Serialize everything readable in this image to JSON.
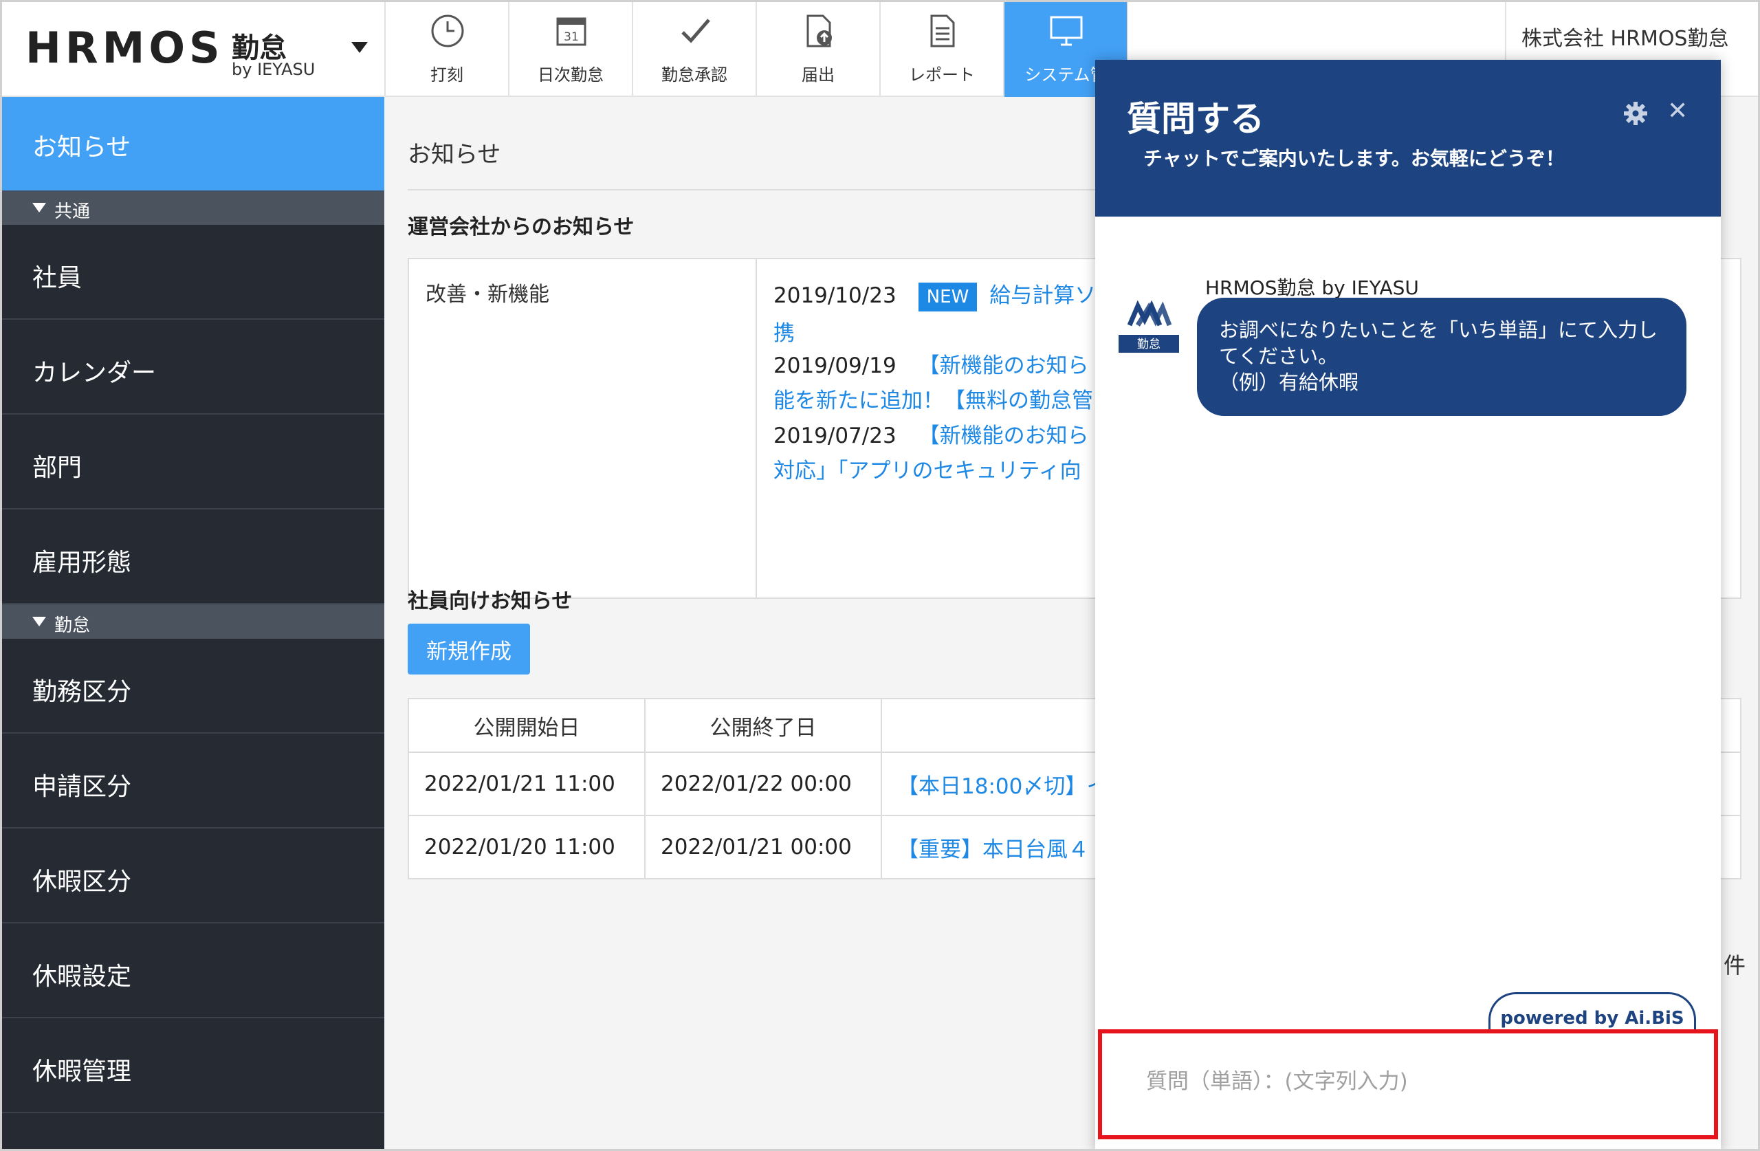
{
  "header": {
    "logo_text": "HRMOS",
    "logo_kintai": "勤怠",
    "logo_by": "by IEYASU",
    "company": "株式会社 HRMOS勤怠",
    "nav": [
      {
        "label": "打刻",
        "icon": "clock-icon"
      },
      {
        "label": "日次勤怠",
        "icon": "calendar-icon"
      },
      {
        "label": "勤怠承認",
        "icon": "checkmark-icon"
      },
      {
        "label": "届出",
        "icon": "document-upload-icon"
      },
      {
        "label": "レポート",
        "icon": "report-icon"
      },
      {
        "label": "システム管",
        "icon": "monitor-icon"
      }
    ]
  },
  "sidebar": {
    "active": "お知らせ",
    "section_common": "共通",
    "section_kintai": "勤怠",
    "items": [
      "社員",
      "カレンダー",
      "部門",
      "雇用形態",
      "勤務区分",
      "申請区分",
      "休暇区分",
      "休暇設定",
      "休暇管理"
    ]
  },
  "main": {
    "title": "お知らせ",
    "operator_title": "運営会社からのお知らせ",
    "category": "改善・新機能",
    "notices": [
      {
        "date": "2019/10/23",
        "badge": "NEW",
        "text": "給与計算ソ",
        "cont": "携"
      },
      {
        "date": "2019/09/19",
        "text": "【新機能のお知ら",
        "cont": "能を新たに追加！【無料の勤怠管"
      },
      {
        "date": "2019/07/23",
        "text": "【新機能のお知ら",
        "cont": "対応」「アプリのセキュリティ向"
      }
    ],
    "employee_title": "社員向けお知らせ",
    "new_button": "新規作成",
    "table": {
      "headers": [
        "公開開始日",
        "公開終了日",
        ""
      ],
      "rows": [
        [
          "2022/01/21 11:00",
          "2022/01/22 00:00",
          "【本日18:00〆切】イ"
        ],
        [
          "2022/01/20 11:00",
          "2022/01/21 00:00",
          "【重要】本日台風４"
        ]
      ]
    },
    "count_suffix": "件"
  },
  "chat": {
    "title": "質問する",
    "subtitle": "チャットでご案内いたします。お気軽にどうぞ！",
    "bot_name": "HRMOS勤怠 by IEYASU",
    "avatar_label": "勤怠",
    "message_lines": [
      "お調べになりたいことを「いち単語」にて入力し",
      "てください。",
      "（例）有給休暇"
    ],
    "powered": "powered by Ai.BiS",
    "input_placeholder": "質問（単語）：(文字列入力)",
    "input_value": "",
    "accent_color": "#1d4380",
    "highlight_color": "#e8141c"
  }
}
